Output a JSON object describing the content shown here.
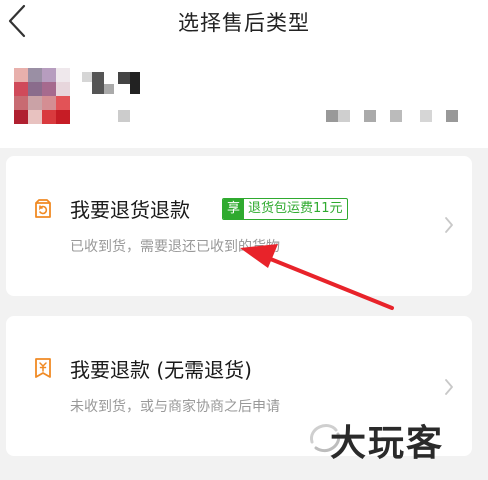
{
  "header": {
    "title": "选择售后类型"
  },
  "options": [
    {
      "title": "我要退货退款",
      "badge_tag": "享",
      "badge_text": "退货包运费11元",
      "subtitle": "已收到货，需要退还已收到的货物"
    },
    {
      "title": "我要退款 (无需退货)",
      "subtitle": "未收到货，或与商家协商之后申请"
    }
  ],
  "watermark": {
    "text": "大玩客"
  },
  "colors": {
    "accent": "#f08a24",
    "badge_green": "#2faa2f",
    "arrow_red": "#e8232a"
  }
}
